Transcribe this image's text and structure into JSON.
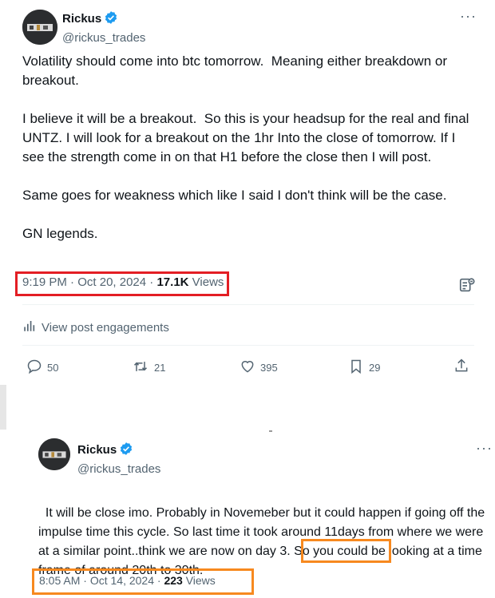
{
  "tweet1": {
    "name": "Rickus",
    "handle": "@rickus_trades",
    "more_icon": "more-horizontal-icon",
    "text": "Volatility should come into btc tomorrow.  Meaning either breakdown or breakout.\n\nI believe it will be a breakout.  So this is your headsup for the real and final UNTZ. I will look for a breakout on the 1hr Into the close of tomorrow. If I see the strength come in on that H1 before the close then I will post.\n\nSame goes for weakness which like I said I don't think will be the case.\n\nGN legends.",
    "time": "9:19 PM",
    "date": "Oct 20, 2024",
    "views_count": "17.1K",
    "views_label": "Views",
    "engagements_label": "View post engagements",
    "actions": {
      "reply": "50",
      "repost": "21",
      "like": "395",
      "bookmark": "29"
    }
  },
  "tweet2": {
    "name": "Rickus",
    "handle": "@rickus_trades",
    "text_before": "It will be close imo. Probably in Novemeber but it could happen if going off the impulse time this cycle. So last time it took around 11days from where we were at a similar point..think we are now on day 3. So you could be looking at a time frame of around ",
    "text_highlight": "20th to 30th.",
    "time": "8:05 AM",
    "date": "Oct 14, 2024",
    "views_count": "223",
    "views_label": "Views"
  },
  "colors": {
    "red_box": "#e31e24",
    "orange_box": "#f7891f",
    "verified": "#1d9bf0",
    "secondary_text": "#536471"
  }
}
